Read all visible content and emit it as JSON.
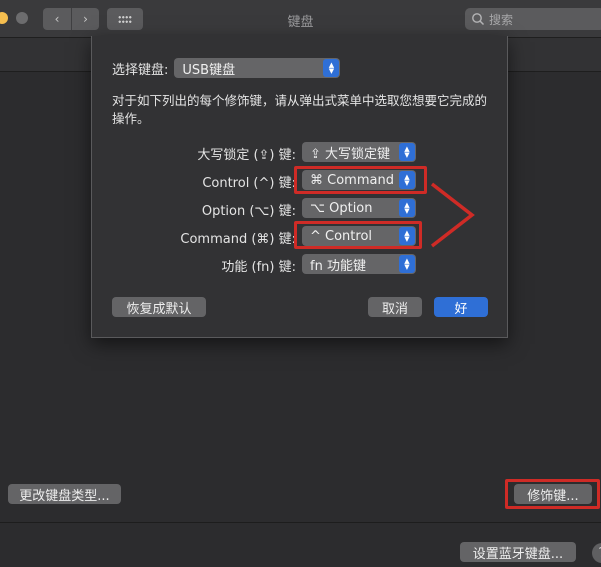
{
  "window": {
    "title": "键盘",
    "search_placeholder": "搜索",
    "nav_back": "‹",
    "nav_forward": "›"
  },
  "sheet": {
    "select_keyboard_label": "选择键盘:",
    "select_keyboard_value": "USB键盘",
    "description": "对于如下列出的每个修饰键，请从弹出式菜单中选取您想要它完成的操作。",
    "modifiers": [
      {
        "label": "大写锁定 (⇪) 键:",
        "value": "⇪ 大写锁定键"
      },
      {
        "label": "Control (^) 键:",
        "value": "⌘ Command"
      },
      {
        "label": "Option (⌥) 键:",
        "value": "⌥ Option"
      },
      {
        "label": "Command (⌘) 键:",
        "value": "^ Control"
      },
      {
        "label": "功能 (fn) 键:",
        "value": "fn 功能键"
      }
    ],
    "restore_defaults_label": "恢复成默认",
    "cancel_label": "取消",
    "ok_label": "好"
  },
  "bottom": {
    "change_type_label": "更改键盘类型...",
    "modifier_keys_label": "修饰键...",
    "bluetooth_label": "设置蓝牙键盘...",
    "help_label": "?"
  },
  "colors": {
    "accent": "#2f6fd6",
    "annotation": "#cf2b26"
  }
}
